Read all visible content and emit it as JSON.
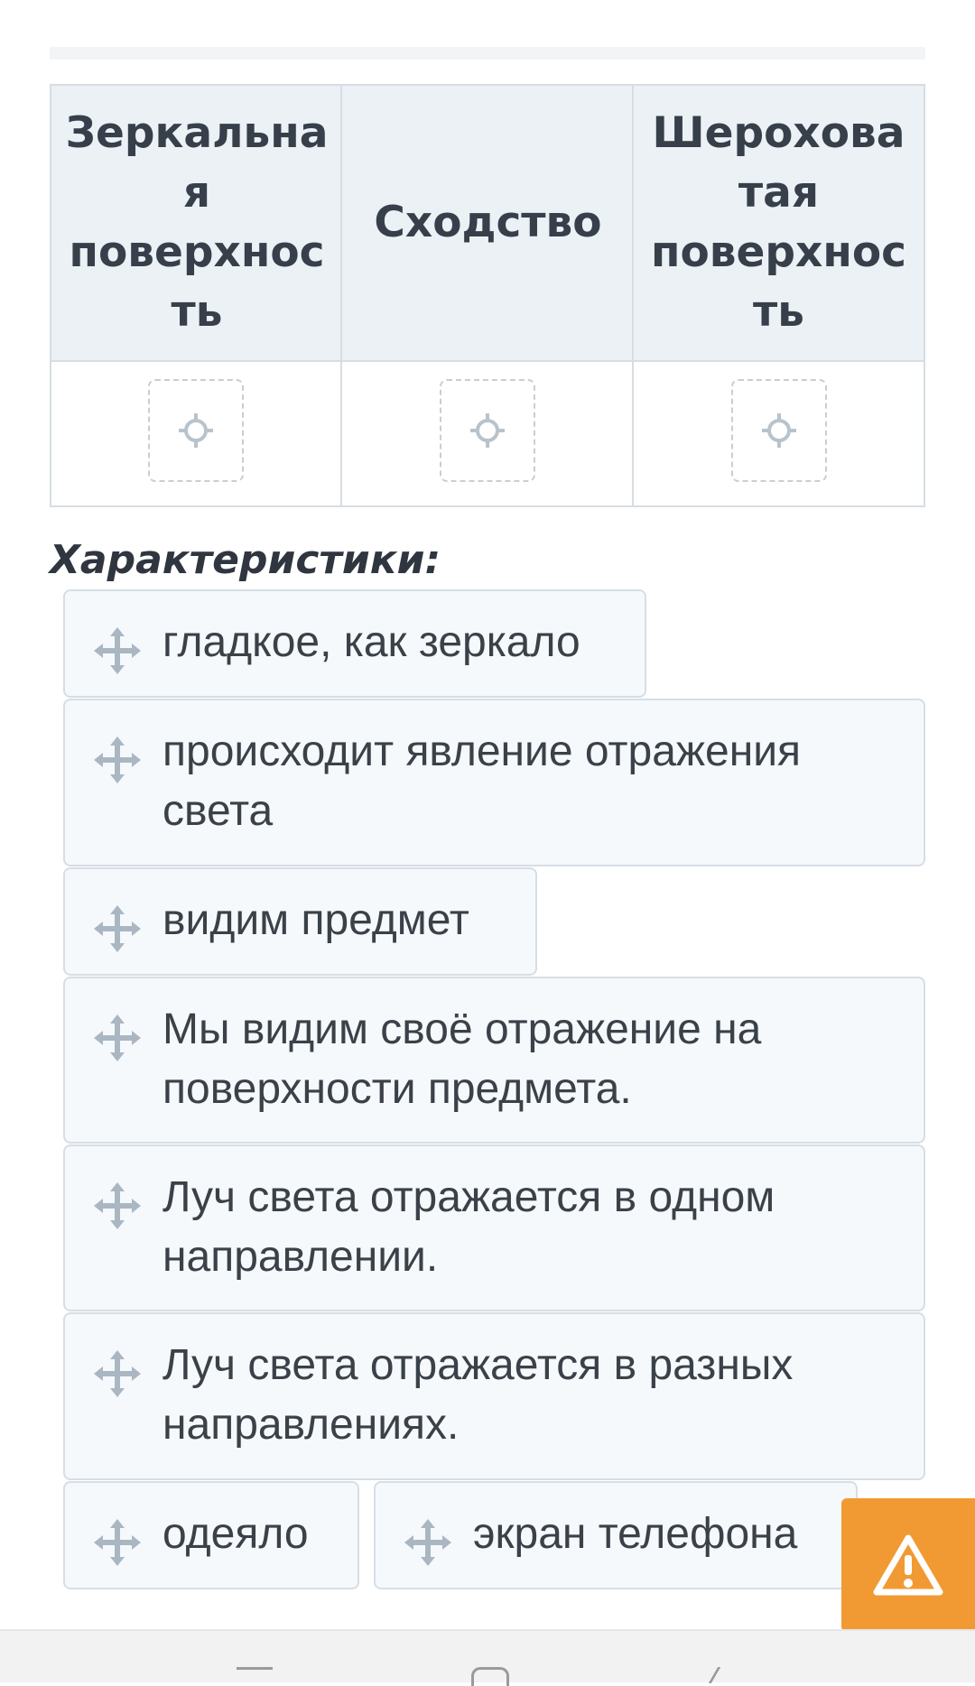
{
  "table": {
    "headers": [
      {
        "lines": [
          "Зеркальна",
          "я",
          "поверхнос",
          "ть"
        ]
      },
      {
        "lines": [
          "Сходство"
        ]
      },
      {
        "lines": [
          "Шерохова",
          "тая",
          "поверхнос",
          "ть"
        ]
      }
    ]
  },
  "section_title": "Характеристики:",
  "cards": [
    {
      "text": "гладкое, как зеркало"
    },
    {
      "text": "происходит явление отражения света"
    },
    {
      "text": "видим предмет"
    },
    {
      "text": "Мы видим своё отражение на поверхности предмета."
    },
    {
      "text": "Луч света отражается в одном направлении."
    },
    {
      "text": "Луч света отражается в разных направлениях."
    },
    {
      "text": "одеяло"
    },
    {
      "text": "экран телефона"
    }
  ],
  "icons": {
    "drop_target": "crosshair-icon",
    "drag_handle": "move-icon",
    "alert": "warning-icon"
  },
  "colors": {
    "header_bg": "#ebf1f5",
    "chip_bg": "#f5f9fc",
    "border": "#d7dde2",
    "alert": "#f19a33"
  }
}
